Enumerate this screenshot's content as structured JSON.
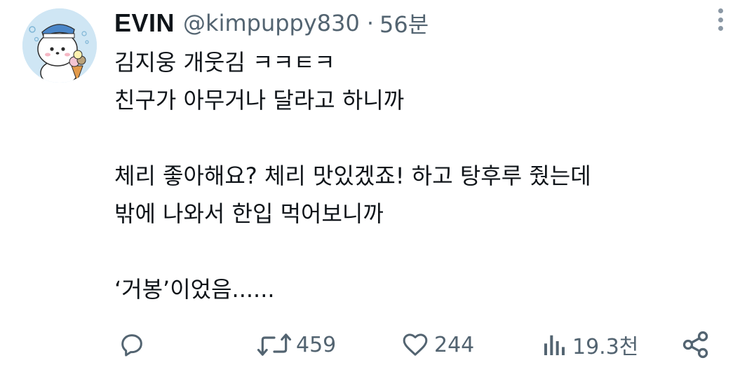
{
  "tweet": {
    "display_name": "EVIN",
    "handle": "@kimpuppy830",
    "separator": "·",
    "time": "56분",
    "lines": [
      "김지웅 개웃김 ㅋㅋㅌㅋ",
      "친구가 아무거나 달라고 하니까",
      "",
      "체리 좋아해요? 체리 맛있겠죠! 하고 탕후루 줬는데",
      "밖에 나와서 한입 먹어보니까",
      "",
      "‘거봉’이었음......"
    ]
  },
  "actions": {
    "reply": {
      "icon": "reply-icon",
      "count": ""
    },
    "retweet": {
      "icon": "retweet-icon",
      "count": "459"
    },
    "like": {
      "icon": "heart-icon",
      "count": "244"
    },
    "views": {
      "icon": "views-icon",
      "count": "19.3천"
    },
    "share": {
      "icon": "share-icon"
    }
  },
  "colors": {
    "text": "#0f1419",
    "secondary": "#536471",
    "avatar_bg": "#cfe6f4"
  }
}
